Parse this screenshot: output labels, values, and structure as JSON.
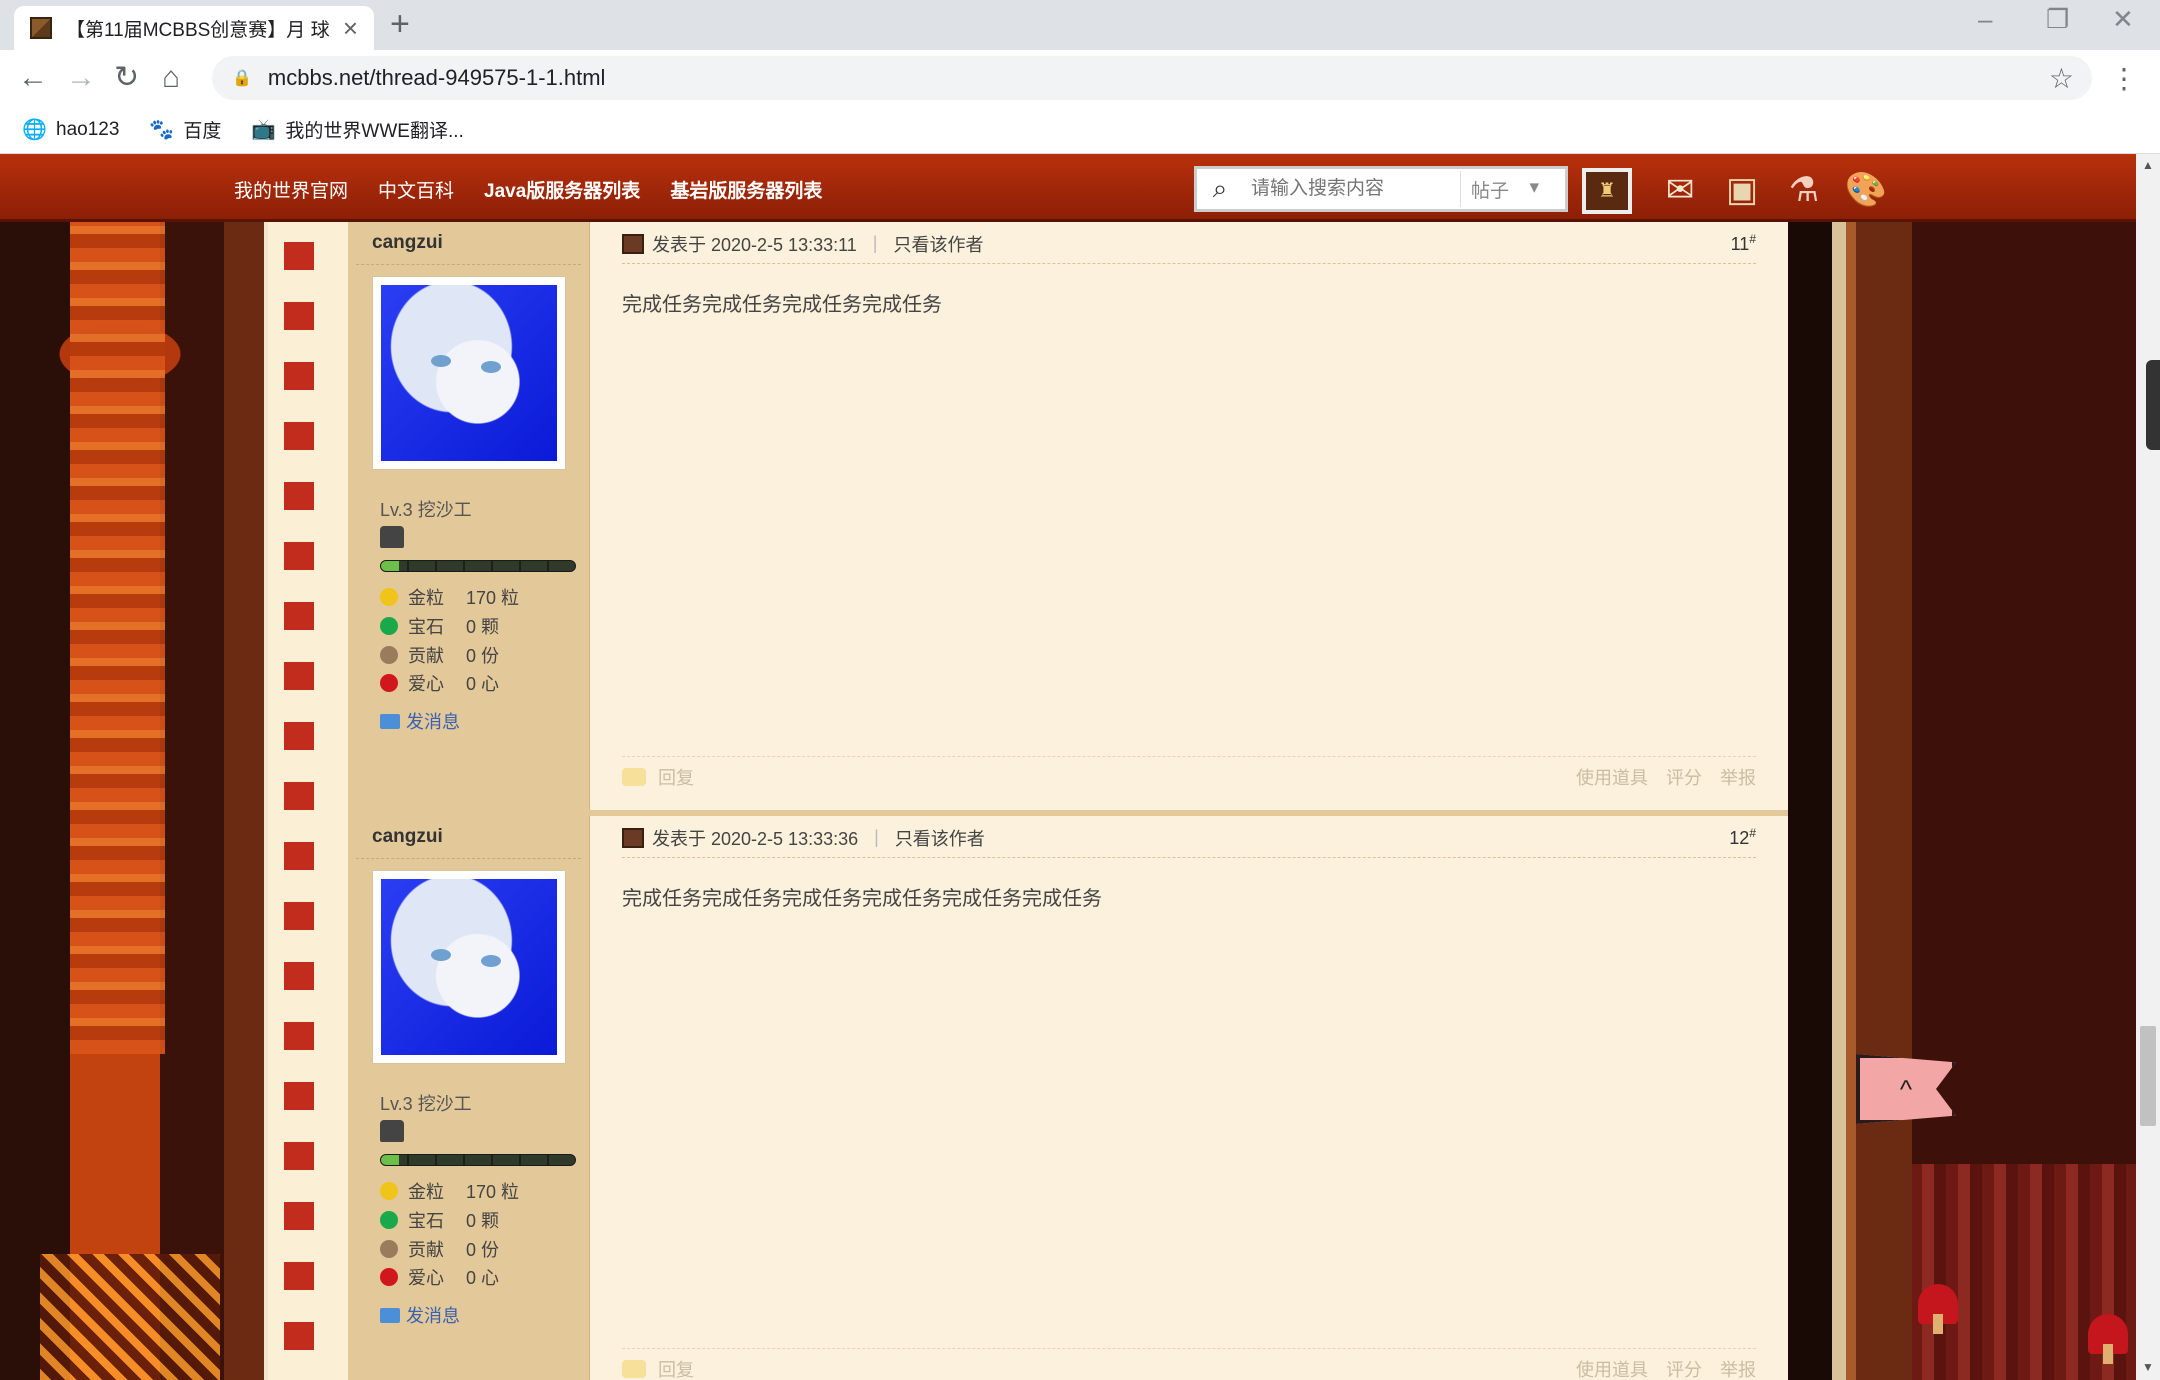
{
  "browser": {
    "tab_title": "【第11届MCBBS创意赛】月 球",
    "url": "mcbbs.net/thread-949575-1-1.html",
    "bookmarks": [
      {
        "label": "hao123",
        "icon": "globe-icon"
      },
      {
        "label": "百度",
        "icon": "baidu-paw-icon"
      },
      {
        "label": "我的世界WWE翻译...",
        "icon": "bilibili-tv-icon"
      }
    ]
  },
  "site_nav": {
    "links": [
      "我的世界官网",
      "中文百科",
      "Java版服务器列表",
      "基岩版服务器列表"
    ],
    "search_placeholder": "请输入搜索内容",
    "search_scope": "帖子",
    "user_glyph": "♜"
  },
  "posts": [
    {
      "author": "cangzui",
      "level": "Lv.3 挖沙工",
      "stats": [
        {
          "key": "金粒",
          "value": "170 粒",
          "color": "#f0c419"
        },
        {
          "key": "宝石",
          "value": "0 颗",
          "color": "#1aa94a"
        },
        {
          "key": "贡献",
          "value": "0 份",
          "color": "#9a7b5c"
        },
        {
          "key": "爱心",
          "value": "0 心",
          "color": "#d0171c"
        }
      ],
      "send_message": "发消息",
      "posted_at": "发表于 2020-2-5 13:33:11",
      "author_only": "只看该作者",
      "floor": "11",
      "floor_mark": "#",
      "content": "完成任务完成任务完成任务完成任务",
      "reply": "回复",
      "use_item": "使用道具",
      "rate": "评分",
      "report": "举报"
    },
    {
      "author": "cangzui",
      "level": "Lv.3 挖沙工",
      "stats": [
        {
          "key": "金粒",
          "value": "170 粒",
          "color": "#f0c419"
        },
        {
          "key": "宝石",
          "value": "0 颗",
          "color": "#1aa94a"
        },
        {
          "key": "贡献",
          "value": "0 份",
          "color": "#9a7b5c"
        },
        {
          "key": "爱心",
          "value": "0 心",
          "color": "#d0171c"
        }
      ],
      "send_message": "发消息",
      "posted_at": "发表于 2020-2-5 13:33:36",
      "author_only": "只看该作者",
      "floor": "12",
      "floor_mark": "#",
      "content": "完成任务完成任务完成任务完成任务完成任务完成任务",
      "reply": "回复",
      "use_item": "使用道具",
      "rate": "评分",
      "report": "举报"
    }
  ],
  "to_top_glyph": "^"
}
